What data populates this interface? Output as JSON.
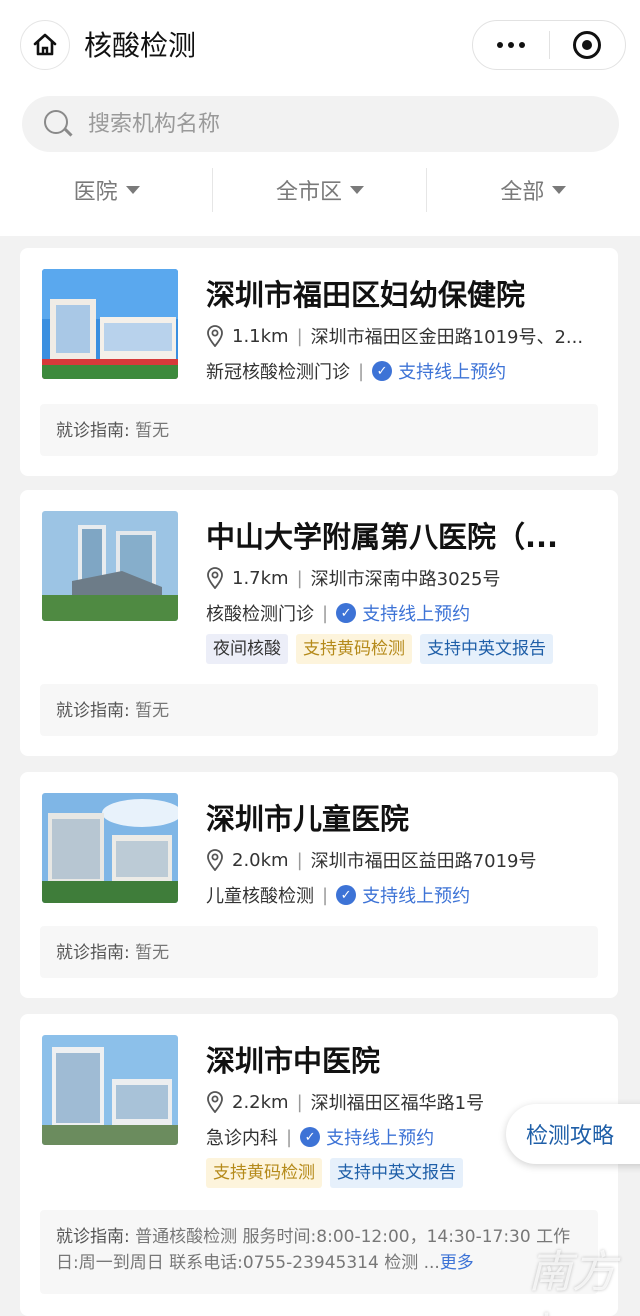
{
  "header": {
    "title": "核酸检测",
    "search_placeholder": "搜索机构名称"
  },
  "filters": [
    {
      "label": "医院"
    },
    {
      "label": "全市区"
    },
    {
      "label": "全部"
    }
  ],
  "common": {
    "guide_label": "就诊指南:",
    "online_label": "支持线上预约"
  },
  "cards": [
    {
      "name": "深圳市福田区妇幼保健院",
      "distance": "1.1km",
      "address": "深圳市福田区金田路1019号、2...",
      "service": "新冠核酸检测门诊",
      "tags": [],
      "guide": "暂无"
    },
    {
      "name": "中山大学附属第八医院（...",
      "distance": "1.7km",
      "address": "深圳市深南中路3025号",
      "service": "核酸检测门诊",
      "tags": [
        {
          "label": "夜间核酸",
          "style": "purple"
        },
        {
          "label": "支持黄码检测",
          "style": "yellow"
        },
        {
          "label": "支持中英文报告",
          "style": "blue"
        }
      ],
      "guide": "暂无"
    },
    {
      "name": "深圳市儿童医院",
      "distance": "2.0km",
      "address": "深圳市福田区益田路7019号",
      "service": "儿童核酸检测",
      "tags": [],
      "guide": "暂无"
    },
    {
      "name": "深圳市中医院",
      "distance": "2.2km",
      "address": "深圳福田区福华路1号",
      "service": "急诊内科",
      "tags": [
        {
          "label": "支持黄码检测",
          "style": "yellow"
        },
        {
          "label": "支持中英文报告",
          "style": "blue"
        }
      ],
      "guide": "普通核酸检测 服务时间:8:00-12:00，14:30-17:30 工作日:周一到周日 联系电话:0755-23945314 检测 ...",
      "guide_more": "更多"
    }
  ],
  "float_button": "检测攻略",
  "watermark": "南方+",
  "colors": {
    "accent": "#3d73d6",
    "tag_yellow": "#b58a1a",
    "tag_blue": "#1f5fa8"
  }
}
